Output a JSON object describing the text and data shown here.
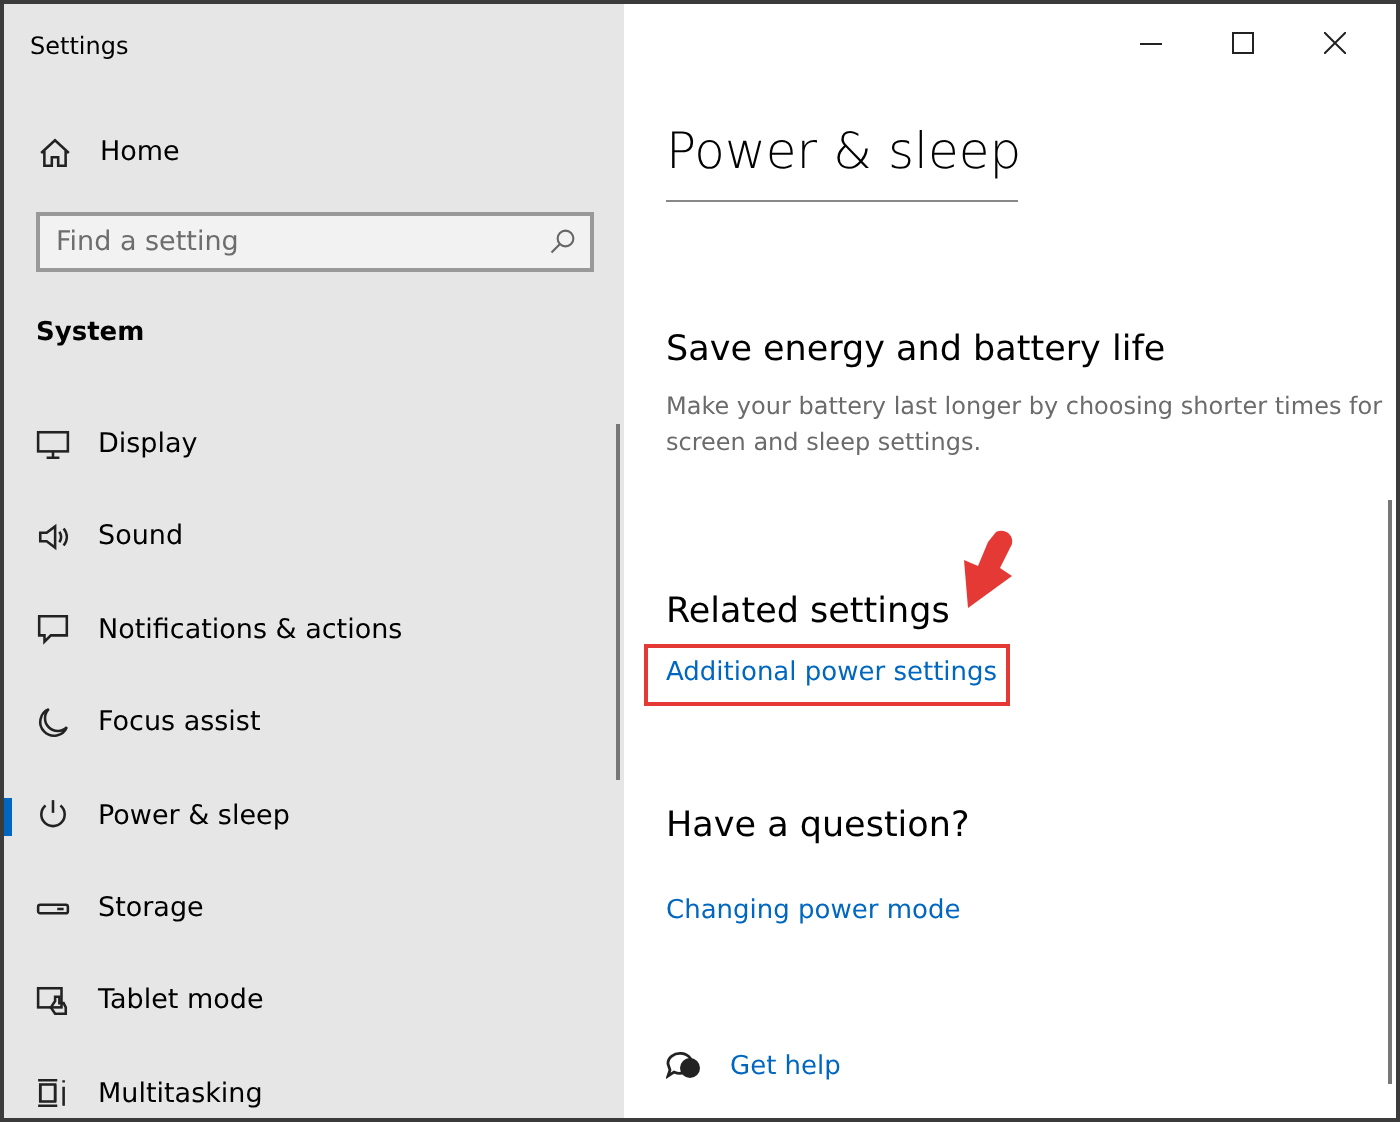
{
  "window": {
    "title": "Settings"
  },
  "sidebar": {
    "home": "Home",
    "search": {
      "placeholder": "Find a setting"
    },
    "section": "System",
    "items": [
      {
        "label": "Display",
        "kind": "display",
        "selected": false
      },
      {
        "label": "Sound",
        "kind": "sound",
        "selected": false
      },
      {
        "label": "Notifications & actions",
        "kind": "notifications",
        "selected": false
      },
      {
        "label": "Focus assist",
        "kind": "moon",
        "selected": false
      },
      {
        "label": "Power & sleep",
        "kind": "power",
        "selected": true
      },
      {
        "label": "Storage",
        "kind": "storage",
        "selected": false
      },
      {
        "label": "Tablet mode",
        "kind": "tablet",
        "selected": false
      },
      {
        "label": "Multitasking",
        "kind": "multitasking",
        "selected": false
      }
    ]
  },
  "content": {
    "title": "Power & sleep",
    "sections": [
      {
        "heading": "Save energy and battery life",
        "text": "Make your battery last longer by choosing shorter times for screen and sleep settings."
      },
      {
        "heading": "Related settings",
        "links": [
          {
            "label": "Additional power settings",
            "highlighted": true
          }
        ]
      },
      {
        "heading": "Have a question?",
        "links": [
          {
            "label": "Changing power mode",
            "highlighted": false
          }
        ]
      }
    ],
    "help": "Get help"
  }
}
